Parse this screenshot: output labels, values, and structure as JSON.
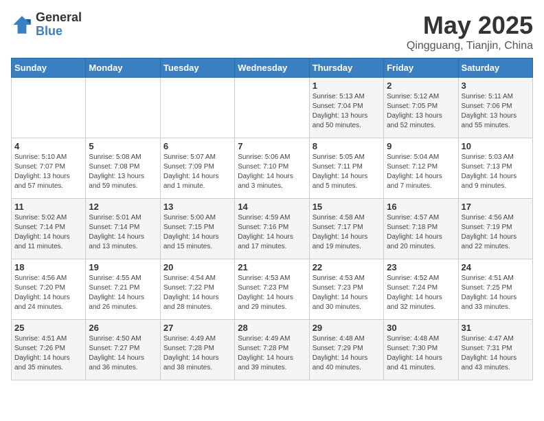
{
  "logo": {
    "general": "General",
    "blue": "Blue"
  },
  "title": "May 2025",
  "subtitle": "Qingguang, Tianjin, China",
  "days_of_week": [
    "Sunday",
    "Monday",
    "Tuesday",
    "Wednesday",
    "Thursday",
    "Friday",
    "Saturday"
  ],
  "weeks": [
    [
      {
        "day": "",
        "info": ""
      },
      {
        "day": "",
        "info": ""
      },
      {
        "day": "",
        "info": ""
      },
      {
        "day": "",
        "info": ""
      },
      {
        "day": "1",
        "info": "Sunrise: 5:13 AM\nSunset: 7:04 PM\nDaylight: 13 hours\nand 50 minutes."
      },
      {
        "day": "2",
        "info": "Sunrise: 5:12 AM\nSunset: 7:05 PM\nDaylight: 13 hours\nand 52 minutes."
      },
      {
        "day": "3",
        "info": "Sunrise: 5:11 AM\nSunset: 7:06 PM\nDaylight: 13 hours\nand 55 minutes."
      }
    ],
    [
      {
        "day": "4",
        "info": "Sunrise: 5:10 AM\nSunset: 7:07 PM\nDaylight: 13 hours\nand 57 minutes."
      },
      {
        "day": "5",
        "info": "Sunrise: 5:08 AM\nSunset: 7:08 PM\nDaylight: 13 hours\nand 59 minutes."
      },
      {
        "day": "6",
        "info": "Sunrise: 5:07 AM\nSunset: 7:09 PM\nDaylight: 14 hours\nand 1 minute."
      },
      {
        "day": "7",
        "info": "Sunrise: 5:06 AM\nSunset: 7:10 PM\nDaylight: 14 hours\nand 3 minutes."
      },
      {
        "day": "8",
        "info": "Sunrise: 5:05 AM\nSunset: 7:11 PM\nDaylight: 14 hours\nand 5 minutes."
      },
      {
        "day": "9",
        "info": "Sunrise: 5:04 AM\nSunset: 7:12 PM\nDaylight: 14 hours\nand 7 minutes."
      },
      {
        "day": "10",
        "info": "Sunrise: 5:03 AM\nSunset: 7:13 PM\nDaylight: 14 hours\nand 9 minutes."
      }
    ],
    [
      {
        "day": "11",
        "info": "Sunrise: 5:02 AM\nSunset: 7:14 PM\nDaylight: 14 hours\nand 11 minutes."
      },
      {
        "day": "12",
        "info": "Sunrise: 5:01 AM\nSunset: 7:14 PM\nDaylight: 14 hours\nand 13 minutes."
      },
      {
        "day": "13",
        "info": "Sunrise: 5:00 AM\nSunset: 7:15 PM\nDaylight: 14 hours\nand 15 minutes."
      },
      {
        "day": "14",
        "info": "Sunrise: 4:59 AM\nSunset: 7:16 PM\nDaylight: 14 hours\nand 17 minutes."
      },
      {
        "day": "15",
        "info": "Sunrise: 4:58 AM\nSunset: 7:17 PM\nDaylight: 14 hours\nand 19 minutes."
      },
      {
        "day": "16",
        "info": "Sunrise: 4:57 AM\nSunset: 7:18 PM\nDaylight: 14 hours\nand 20 minutes."
      },
      {
        "day": "17",
        "info": "Sunrise: 4:56 AM\nSunset: 7:19 PM\nDaylight: 14 hours\nand 22 minutes."
      }
    ],
    [
      {
        "day": "18",
        "info": "Sunrise: 4:56 AM\nSunset: 7:20 PM\nDaylight: 14 hours\nand 24 minutes."
      },
      {
        "day": "19",
        "info": "Sunrise: 4:55 AM\nSunset: 7:21 PM\nDaylight: 14 hours\nand 26 minutes."
      },
      {
        "day": "20",
        "info": "Sunrise: 4:54 AM\nSunset: 7:22 PM\nDaylight: 14 hours\nand 28 minutes."
      },
      {
        "day": "21",
        "info": "Sunrise: 4:53 AM\nSunset: 7:23 PM\nDaylight: 14 hours\nand 29 minutes."
      },
      {
        "day": "22",
        "info": "Sunrise: 4:53 AM\nSunset: 7:23 PM\nDaylight: 14 hours\nand 30 minutes."
      },
      {
        "day": "23",
        "info": "Sunrise: 4:52 AM\nSunset: 7:24 PM\nDaylight: 14 hours\nand 32 minutes."
      },
      {
        "day": "24",
        "info": "Sunrise: 4:51 AM\nSunset: 7:25 PM\nDaylight: 14 hours\nand 33 minutes."
      }
    ],
    [
      {
        "day": "25",
        "info": "Sunrise: 4:51 AM\nSunset: 7:26 PM\nDaylight: 14 hours\nand 35 minutes."
      },
      {
        "day": "26",
        "info": "Sunrise: 4:50 AM\nSunset: 7:27 PM\nDaylight: 14 hours\nand 36 minutes."
      },
      {
        "day": "27",
        "info": "Sunrise: 4:49 AM\nSunset: 7:28 PM\nDaylight: 14 hours\nand 38 minutes."
      },
      {
        "day": "28",
        "info": "Sunrise: 4:49 AM\nSunset: 7:28 PM\nDaylight: 14 hours\nand 39 minutes."
      },
      {
        "day": "29",
        "info": "Sunrise: 4:48 AM\nSunset: 7:29 PM\nDaylight: 14 hours\nand 40 minutes."
      },
      {
        "day": "30",
        "info": "Sunrise: 4:48 AM\nSunset: 7:30 PM\nDaylight: 14 hours\nand 41 minutes."
      },
      {
        "day": "31",
        "info": "Sunrise: 4:47 AM\nSunset: 7:31 PM\nDaylight: 14 hours\nand 43 minutes."
      }
    ]
  ]
}
